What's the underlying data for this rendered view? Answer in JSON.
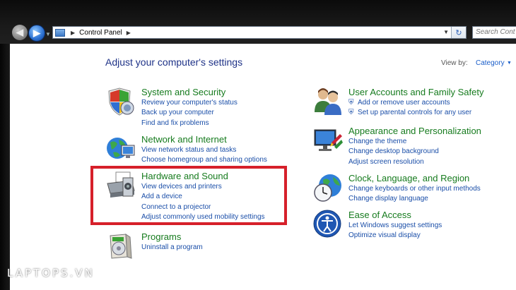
{
  "address_bar": {
    "crumb": "Control Panel",
    "search_placeholder": "Search Cont"
  },
  "header": {
    "title": "Adjust your computer's settings",
    "view_by_label": "View by:",
    "view_by_value": "Category"
  },
  "categories_left": [
    {
      "title": "System and Security",
      "links": [
        "Review your computer's status",
        "Back up your computer",
        "Find and fix problems"
      ]
    },
    {
      "title": "Network and Internet",
      "links": [
        "View network status and tasks",
        "Choose homegroup and sharing options"
      ]
    },
    {
      "title": "Hardware and Sound",
      "links": [
        "View devices and printers",
        "Add a device",
        "Connect to a projector",
        "Adjust commonly used mobility settings"
      ]
    },
    {
      "title": "Programs",
      "links": [
        "Uninstall a program"
      ]
    }
  ],
  "categories_right": [
    {
      "title": "User Accounts and Family Safety",
      "links": [
        "Add or remove user accounts",
        "Set up parental controls for any user"
      ]
    },
    {
      "title": "Appearance and Personalization",
      "links": [
        "Change the theme",
        "Change desktop background",
        "Adjust screen resolution"
      ]
    },
    {
      "title": "Clock, Language, and Region",
      "links": [
        "Change keyboards or other input methods",
        "Change display language"
      ]
    },
    {
      "title": "Ease of Access",
      "links": [
        "Let Windows suggest settings",
        "Optimize visual display"
      ]
    }
  ],
  "watermark": "LAPTOPS.VN",
  "colors": {
    "category_title": "#167b1e",
    "link": "#1a4ea8",
    "page_title": "#1e3287",
    "highlight_box": "#d6202a"
  },
  "icons": {
    "system_security": "shield-icon",
    "network": "globe-network-icon",
    "hardware": "printer-icon",
    "programs": "software-box-icon",
    "user_accounts": "users-icon",
    "appearance": "monitor-paint-icon",
    "clock": "clock-globe-icon",
    "ease_of_access": "ease-of-access-icon"
  }
}
